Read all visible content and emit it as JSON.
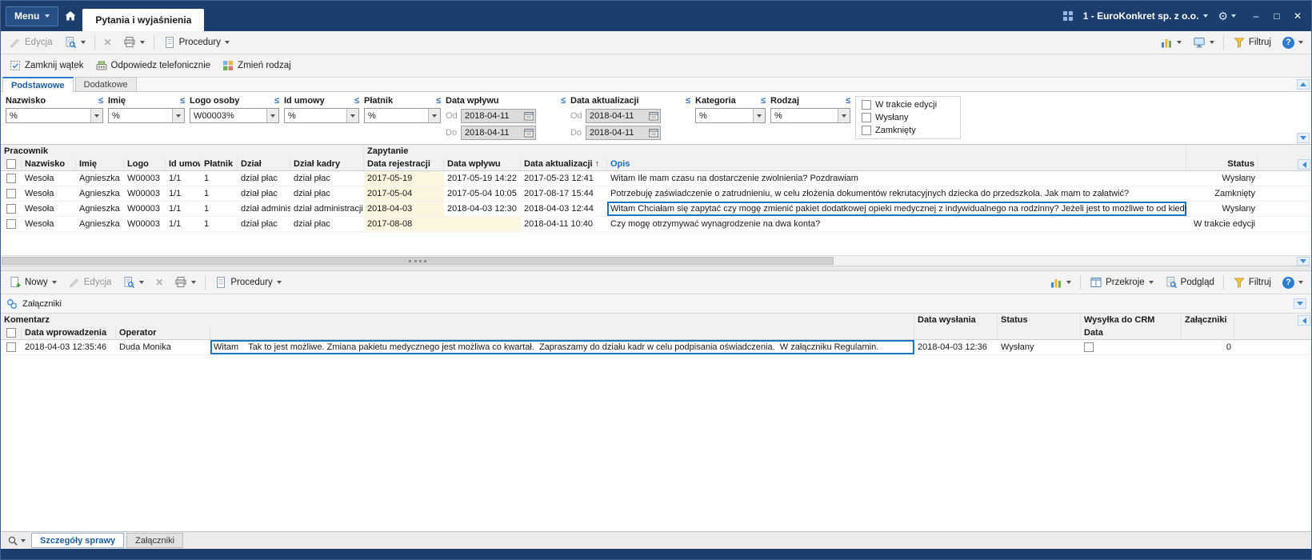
{
  "colors": {
    "titlebar": "#1b3e6d",
    "accent": "#2b7cd3",
    "selection_border": "#1d76c4",
    "highlight_cell": "#fbf6df"
  },
  "glyphs": {
    "sort_asc": "↑",
    "op_lte": "≤",
    "minimize": "–",
    "maximize": "□",
    "close": "✕",
    "gear": "⚙",
    "delete_x": "✕",
    "help_q": "?"
  },
  "titlebar": {
    "menu_label": "Menu",
    "active_tab": "Pytania i wyjaśnienia",
    "company": "1 - EuroKonkret sp. z o.o."
  },
  "toolbar_main": {
    "edit_label": "Edycja",
    "procedures_label": "Procedury",
    "filter_label": "Filtruj"
  },
  "action_bar": {
    "close_thread_label": "Zamknij wątek",
    "answer_phone_label": "Odpowiedz telefonicznie",
    "change_type_label": "Zmień rodzaj"
  },
  "filter_panel": {
    "tabs": [
      {
        "label": "Podstawowe",
        "active": true
      },
      {
        "label": "Dodatkowe",
        "active": false
      }
    ],
    "fields": [
      {
        "label": "Nazwisko",
        "value": "%"
      },
      {
        "label": "Imię",
        "value": "%"
      },
      {
        "label": "Logo osoby",
        "value": "W00003%"
      },
      {
        "label": "Id umowy",
        "value": "%"
      },
      {
        "label": "Płatnik",
        "value": "%"
      }
    ],
    "date_ranges": [
      {
        "label": "Data wpływu",
        "od_label": "Od",
        "do_label": "Do",
        "od_value": "2018-04-11",
        "do_value": "2018-04-11"
      },
      {
        "label": "Data aktualizacji",
        "od_label": "Od",
        "do_label": "Do",
        "od_value": "2018-04-11",
        "do_value": "2018-04-11"
      }
    ],
    "selects": [
      {
        "label": "Kategoria",
        "value": "%"
      },
      {
        "label": "Rodzaj",
        "value": "%"
      }
    ],
    "checkboxes": [
      {
        "label": "W trakcie edycji",
        "checked": false
      },
      {
        "label": "Wysłany",
        "checked": false
      },
      {
        "label": "Zamknięty",
        "checked": false
      }
    ]
  },
  "threads_grid": {
    "groups": {
      "pracownik": "Pracownik",
      "zapytanie": "Zapytanie"
    },
    "columns": {
      "nazwisko": "Nazwisko",
      "imie": "Imię",
      "logo": "Logo",
      "id_umowy": "Id umowy",
      "platnik": "Płatnik",
      "dzial": "Dział",
      "dzial_kadry": "Dział kadry",
      "data_rejestracji": "Data rejestracji",
      "data_wplywu": "Data wpływu",
      "data_aktualizacji": "Data aktualizacji",
      "opis": "Opis",
      "status": "Status"
    },
    "rows": [
      {
        "nazwisko": "Wesoła",
        "imie": "Agnieszka",
        "logo": "W00003",
        "id_umowy": "1/1",
        "platnik": "1",
        "dzial": "dział płac",
        "dzial_kadry": "dział płac",
        "data_rejestracji": "2017-05-19",
        "data_wplywu": "2017-05-19 14:22",
        "data_aktualizacji": "2017-05-23 12:41",
        "opis": "Witam Ile mam czasu na dostarczenie zwolnienia? Pozdrawiam",
        "status": "Wysłany",
        "selected": false
      },
      {
        "nazwisko": "Wesoła",
        "imie": "Agnieszka",
        "logo": "W00003",
        "id_umowy": "1/1",
        "platnik": "1",
        "dzial": "dział płac",
        "dzial_kadry": "dział płac",
        "data_rejestracji": "2017-05-04",
        "data_wplywu": "2017-05-04 10:05",
        "data_aktualizacji": "2017-08-17 15:44",
        "opis": "Potrzebuję zaświadczenie o zatrudnieniu, w celu złożenia dokumentów rekrutacyjnych dziecka do przedszkola. Jak mam to załatwić?",
        "status": "Zamknięty",
        "selected": false
      },
      {
        "nazwisko": "Wesoła",
        "imie": "Agnieszka",
        "logo": "W00003",
        "id_umowy": "1/1",
        "platnik": "1",
        "dzial": "dział administracji",
        "dzial_kadry": "dział administracji",
        "data_rejestracji": "2018-04-03",
        "data_wplywu": "2018-04-03 12:30",
        "data_aktualizacji": "2018-04-03 12:44",
        "opis": "Witam Chciałam się zapytać czy mogę zmienić pakiet dodatkowej opieki medycznej z indywidualnego na rodzinny? Jeżeli jest to możliwe to od kiedy?",
        "status": "Wysłany",
        "selected": true
      },
      {
        "nazwisko": "Wesoła",
        "imie": "Agnieszka",
        "logo": "W00003",
        "id_umowy": "1/1",
        "platnik": "1",
        "dzial": "dział płac",
        "dzial_kadry": "dział płac",
        "data_rejestracji": "2017-08-08",
        "data_wplywu": "",
        "data_aktualizacji": "2018-04-11 10:40",
        "opis": "Czy mogę otrzymywać wynagrodzenie na dwa konta?",
        "status": "W trakcie edycji",
        "selected": false
      }
    ]
  },
  "toolbar_lower": {
    "new_label": "Nowy",
    "edit_label": "Edycja",
    "procedures_label": "Procedury",
    "sections_label": "Przekroje",
    "preview_label": "Podgląd",
    "filter_label": "Filtruj"
  },
  "attachments_bar": {
    "label": "Załączniki"
  },
  "answers_grid": {
    "groups": {
      "komentarz": "Komentarz"
    },
    "columns": {
      "data_wprowadzenia": "Data wprowadzenia",
      "operator": "Operator",
      "data_wyslania": "Data wysłania",
      "status": "Status",
      "wysylka_crm": "Wysyłka do CRM",
      "crm_data": "Data",
      "zalaczniki": "Załączniki"
    },
    "rows": [
      {
        "data_wprowadzenia": "2018-04-03 12:35:46",
        "operator": "Duda Monika",
        "komentarz": "Witam    Tak to jest możliwe. Zmiana pakietu medycznego jest możliwa co kwartał.  Zapraszamy do działu kadr w celu podpisania oświadczenia.  W załączniku Regulamin.",
        "data_wyslania": "2018-04-03 12:36",
        "status": "Wysłany",
        "wysylka_crm_checked": false,
        "zalaczniki": "0"
      }
    ]
  },
  "bottom_tabs": [
    {
      "label": "Szczegóły sprawy",
      "active": true
    },
    {
      "label": "Załączniki",
      "active": false
    }
  ]
}
